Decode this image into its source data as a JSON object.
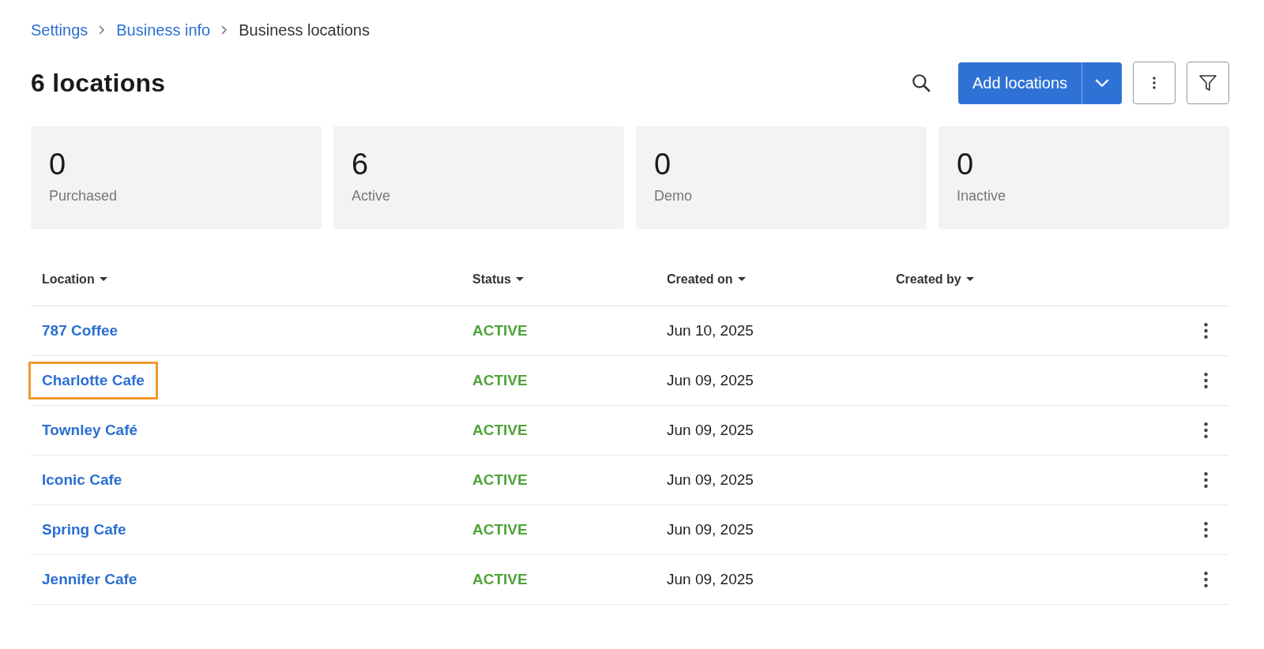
{
  "breadcrumb": [
    {
      "label": "Settings",
      "link": true
    },
    {
      "label": "Business info",
      "link": true
    },
    {
      "label": "Business locations",
      "link": false
    }
  ],
  "title": "6 locations",
  "toolbar": {
    "add_button": "Add locations"
  },
  "stats": [
    {
      "value": "0",
      "label": "Purchased"
    },
    {
      "value": "6",
      "label": "Active"
    },
    {
      "value": "0",
      "label": "Demo"
    },
    {
      "value": "0",
      "label": "Inactive"
    }
  ],
  "table": {
    "columns": [
      "Location",
      "Status",
      "Created on",
      "Created by"
    ],
    "rows": [
      {
        "location": "787 Coffee",
        "status": "ACTIVE",
        "created_on": "Jun 10, 2025",
        "highlighted": false
      },
      {
        "location": "Charlotte Cafe",
        "status": "ACTIVE",
        "created_on": "Jun 09, 2025",
        "highlighted": true
      },
      {
        "location": "Townley Café",
        "status": "ACTIVE",
        "created_on": "Jun 09, 2025",
        "highlighted": false
      },
      {
        "location": "Iconic Cafe",
        "status": "ACTIVE",
        "created_on": "Jun 09, 2025",
        "highlighted": false
      },
      {
        "location": "Spring Cafe",
        "status": "ACTIVE",
        "created_on": "Jun 09, 2025",
        "highlighted": false
      },
      {
        "location": "Jennifer Cafe",
        "status": "ACTIVE",
        "created_on": "Jun 09, 2025",
        "highlighted": false
      }
    ]
  }
}
